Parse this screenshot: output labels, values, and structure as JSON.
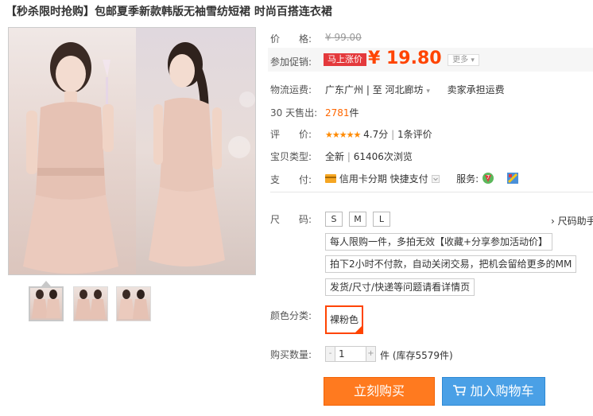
{
  "product": {
    "title": "【秒杀限时抢购】包邮夏季新款韩版无袖雪纺短裙 时尚百搭连衣裙"
  },
  "price": {
    "label": "价　　格:",
    "original": "¥ 99.00",
    "promo_label": "参加促销:",
    "promo_badge": "马上涨价",
    "current": "¥ 19.80",
    "more": "更多"
  },
  "shipping": {
    "label": "物流运费:",
    "from": "广东广州",
    "sep": "| 至",
    "to": "河北廊坊",
    "note": "卖家承担运费"
  },
  "sales": {
    "label": "30 天售出:",
    "count": "2781",
    "unit": "件"
  },
  "rating": {
    "label": "评　　价:",
    "stars": "★★★★★",
    "score": "4.7分",
    "reviews": "1条评价",
    "sep": "|"
  },
  "item_type": {
    "label": "宝贝类型:",
    "value": "全新",
    "sep": "|",
    "views": "61406次浏览"
  },
  "payment": {
    "label": "支　　付:",
    "credit": "信用卡分期",
    "quick": "快捷支付",
    "service_label": "服务:"
  },
  "size": {
    "label": "尺　　码:",
    "options": [
      "S",
      "M",
      "L"
    ],
    "guide": "› 尺码助手"
  },
  "notices": [
    "每人限购一件，多拍无效【收藏+分享参加活动价】",
    "拍下2小时不付款，自动关闭交易，把机会留给更多的MM",
    "发货/尺寸/快递等问题请看详情页"
  ],
  "color": {
    "label": "颜色分类:",
    "selected": "裸粉色"
  },
  "quantity": {
    "label": "购买数量:",
    "value": "1",
    "minus": "-",
    "plus": "+",
    "stock": "件 (库存5579件)"
  },
  "actions": {
    "buy": "立刻购买",
    "cart": "加入购物车"
  },
  "colors": {
    "accent": "#ff4400",
    "buy": "#ff7a1f",
    "cart": "#4aa0e6"
  }
}
